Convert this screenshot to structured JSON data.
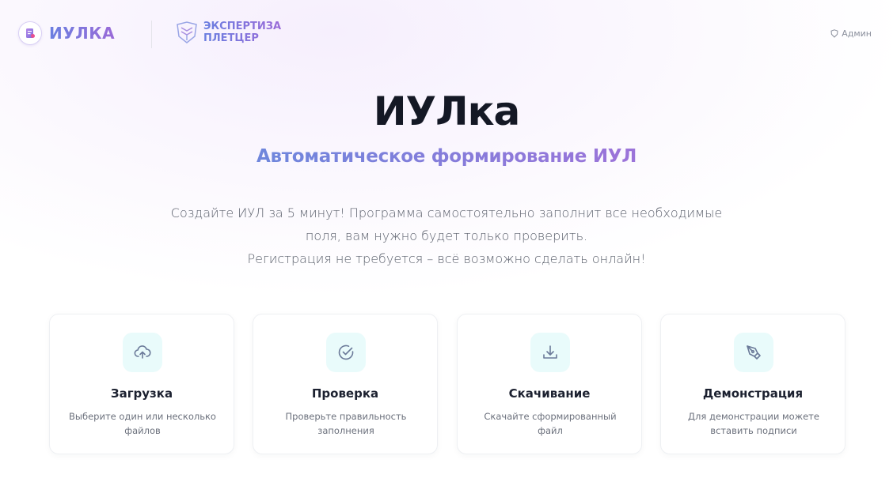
{
  "header": {
    "brand_name": "ИУЛКА",
    "partner_line1": "ЭКСПЕРТИЗА",
    "partner_line2": "ПЛЕТЦЕР",
    "admin_label": "Админ"
  },
  "hero": {
    "title": "ИУЛка",
    "subtitle": "Автоматическое формирование ИУЛ",
    "description_lines": [
      "Создайте ИУЛ за 5 минут! Программа самостоятельно заполнит все необходимые",
      "поля, вам нужно будет только проверить.",
      "Регистрация не требуется – всё возможно сделать онлайн!"
    ]
  },
  "cards": [
    {
      "icon": "cloud-upload-icon",
      "title": "Загрузка",
      "desc_line1": "Выберите один или несколько",
      "desc_line2": "файлов"
    },
    {
      "icon": "check-circle-icon",
      "title": "Проверка",
      "desc_line1": "Проверьте правильность",
      "desc_line2": "заполнения"
    },
    {
      "icon": "download-icon",
      "title": "Скачивание",
      "desc_line1": "Скачайте сформированный",
      "desc_line2": "файл"
    },
    {
      "icon": "pen-tool-icon",
      "title": "Демонстрация",
      "desc_line1": "Для демонстрации можете",
      "desc_line2": "вставить подписи"
    }
  ],
  "colors": {
    "accent_start": "#6a7fe0",
    "accent_end": "#9a6ad8",
    "icon_bg": "#e9fbfb",
    "icon_stroke": "#6b7a99"
  }
}
